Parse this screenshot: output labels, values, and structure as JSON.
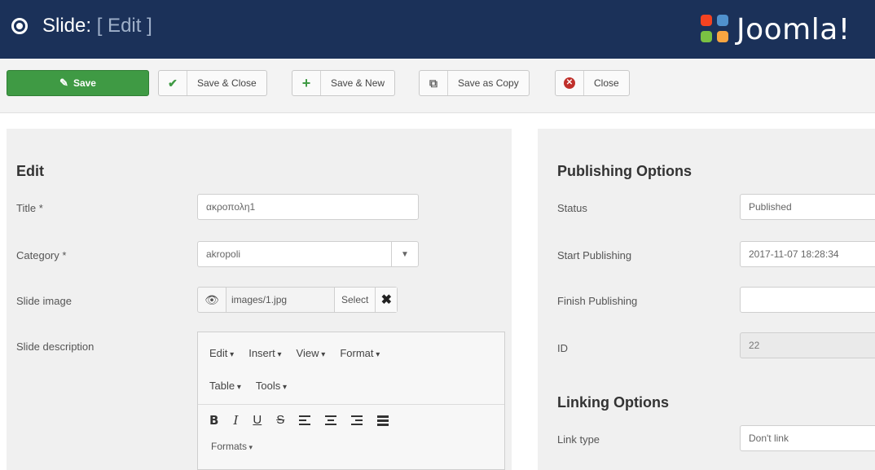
{
  "header": {
    "title_prefix": "Slide:",
    "title_suffix": "[ Edit ]",
    "brand": "Joomla!",
    "brand_colors": [
      "#f44321",
      "#5091cd",
      "#7ac143",
      "#f9a541"
    ]
  },
  "toolbar": {
    "save_label": "Save",
    "save_close_label": "Save & Close",
    "save_new_label": "Save & New",
    "save_copy_label": "Save as Copy",
    "close_label": "Close",
    "save_color": "#3f9a44",
    "check_color": "#3f9a44",
    "close_icon_color": "#c0302b"
  },
  "edit": {
    "heading": "Edit",
    "title_label": "Title *",
    "title_value": "ακροπολη1",
    "category_label": "Category *",
    "category_value": "akropoli",
    "image_label": "Slide image",
    "image_path": "images/1.jpg",
    "image_select": "Select",
    "description_label": "Slide description",
    "editor": {
      "menu1": [
        "Edit",
        "Insert",
        "View",
        "Format"
      ],
      "menu2": [
        "Table",
        "Tools"
      ],
      "formats_label": "Formats"
    }
  },
  "publishing": {
    "heading": "Publishing Options",
    "status_label": "Status",
    "status_value": "Published",
    "start_label": "Start Publishing",
    "start_value": "2017-11-07 18:28:34",
    "finish_label": "Finish Publishing",
    "finish_value": "",
    "id_label": "ID",
    "id_value": "22"
  },
  "linking": {
    "heading": "Linking Options",
    "link_type_label": "Link type",
    "link_type_value": "Don't link"
  }
}
